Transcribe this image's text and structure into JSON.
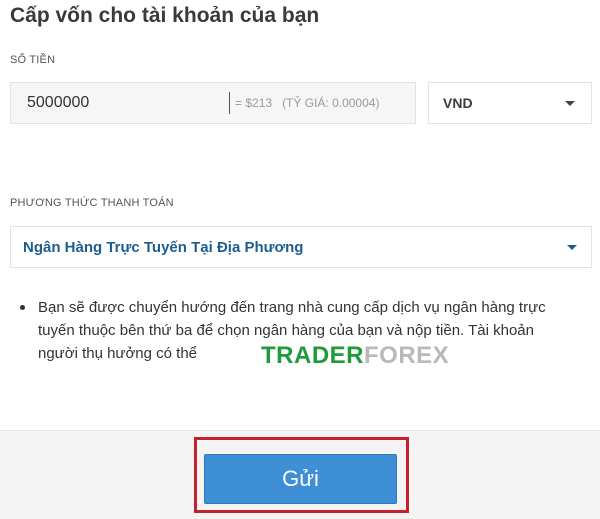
{
  "title": "Cấp vốn cho tài khoản của bạn",
  "amount": {
    "label": "SỐ TIỀN",
    "value": "5000000",
    "conversion": "= $213",
    "rate": "(TỶ GIÁ: 0.00004)"
  },
  "currency": {
    "value": "VND",
    "icon": "chevron-down-icon"
  },
  "payment_method": {
    "label": "PHƯƠNG THỨC THANH TOÁN",
    "value": "Ngân Hàng Trực Tuyến Tại Địa Phương",
    "icon": "chevron-down-icon",
    "accent_color": "#1e5d8f"
  },
  "info_text": "Bạn sẽ được chuyển hướng đến trang nhà cung cấp dịch vụ ngân hàng trực tuyến thuộc bên thứ ba để chọn ngân hàng của bạn và nộp tiền. Tài khoản người thụ hưởng có thể",
  "watermark": {
    "part1": "TRADER",
    "part2": "FOREX"
  },
  "submit": {
    "label": "Gửi",
    "color": "#3e8fd6",
    "highlight_color": "#c8202a"
  }
}
